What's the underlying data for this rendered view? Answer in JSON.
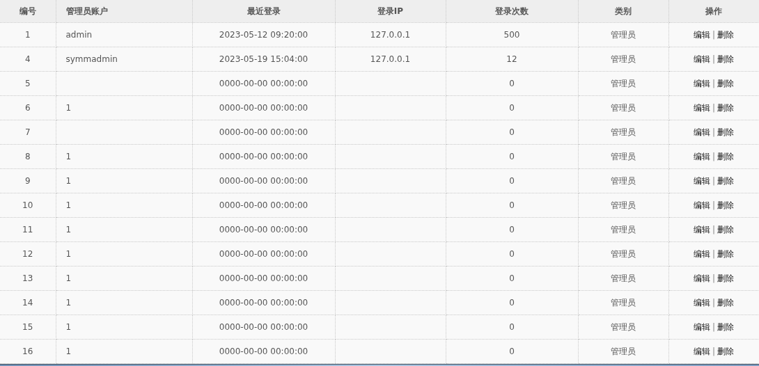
{
  "table": {
    "columns": [
      "编号",
      "管理员账户",
      "最近登录",
      "登录IP",
      "登录次数",
      "类别",
      "操作"
    ],
    "rows": [
      {
        "id": "1",
        "account": "admin",
        "last_login": "2023-05-12 09:20:00",
        "ip": "127.0.0.1",
        "count": "500",
        "category": "管理员",
        "actions": [
          "编辑",
          "|",
          "删除"
        ]
      },
      {
        "id": "4",
        "account": "symmadmin",
        "last_login": "2023-05-19 15:04:00",
        "ip": "127.0.0.1",
        "count": "12",
        "category": "管理员",
        "actions": [
          "编辑",
          "|",
          "删除"
        ]
      },
      {
        "id": "5",
        "last_login": "0000-00-00 00:00:00",
        "count": "0",
        "category": "管理员",
        "actions": [
          "编辑",
          "|",
          "删除"
        ]
      },
      {
        "id": "6",
        "account": "1",
        "last_login": "0000-00-00 00:00:00",
        "count": "0",
        "category": "管理员",
        "actions": [
          "编辑",
          "|",
          "删除"
        ]
      },
      {
        "id": "7",
        "last_login": "0000-00-00 00:00:00",
        "count": "0",
        "category": "管理员",
        "actions": [
          "编辑",
          "|",
          "删除"
        ]
      },
      {
        "id": "8",
        "account": "1",
        "last_login": "0000-00-00 00:00:00",
        "count": "0",
        "category": "管理员",
        "actions": [
          "编辑",
          "|",
          "删除"
        ]
      },
      {
        "id": "9",
        "account": "1",
        "last_login": "0000-00-00 00:00:00",
        "count": "0",
        "category": "管理员",
        "actions": [
          "编辑",
          "|",
          "删除"
        ]
      },
      {
        "id": "10",
        "account": "1",
        "last_login": "0000-00-00 00:00:00",
        "count": "0",
        "category": "管理员",
        "actions": [
          "编辑",
          "|",
          "删除"
        ]
      },
      {
        "id": "11",
        "account": "1",
        "last_login": "0000-00-00 00:00:00",
        "count": "0",
        "category": "管理员",
        "actions": [
          "编辑",
          "|",
          "删除"
        ]
      },
      {
        "id": "12",
        "account": "1",
        "last_login": "0000-00-00 00:00:00",
        "count": "0",
        "category": "管理员",
        "actions": [
          "编辑",
          "|",
          "删除"
        ]
      },
      {
        "id": "13",
        "account": "1",
        "last_login": "0000-00-00 00:00:00",
        "count": "0",
        "category": "管理员",
        "actions": [
          "编辑",
          "|",
          "删除"
        ]
      },
      {
        "id": "14",
        "account": "1",
        "last_login": "0000-00-00 00:00:00",
        "count": "0",
        "category": "管理员",
        "actions": [
          "编辑",
          "|",
          "删除"
        ]
      },
      {
        "id": "15",
        "account": "1",
        "last_login": "0000-00-00 00:00:00",
        "count": "0",
        "category": "管理员",
        "actions": [
          "编辑",
          "|",
          "删除"
        ]
      },
      {
        "id": "16",
        "account": "1",
        "last_login": "0000-00-00 00:00:00",
        "count": "0",
        "category": "管理员",
        "actions": [
          "编辑",
          "|",
          "删除"
        ]
      }
    ]
  }
}
